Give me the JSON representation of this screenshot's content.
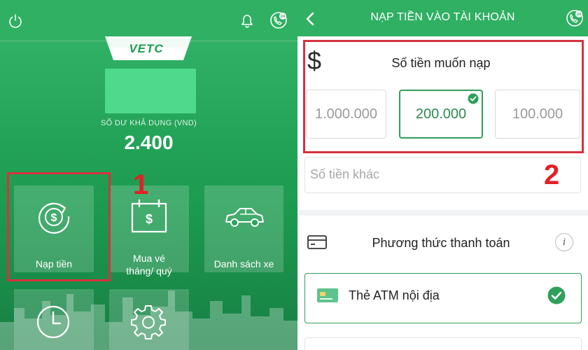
{
  "left": {
    "logo": "VETC",
    "balance_label": "SỐ DƯ KHẢ DỤNG (VND)",
    "balance_value": "2.400",
    "tiles": [
      {
        "label": "Nạp tiền"
      },
      {
        "label": "Mua vé tháng/ quý",
        "line1": "Mua vé",
        "line2": "tháng/ quý"
      },
      {
        "label": "Danh sách xe"
      }
    ],
    "marker": "1",
    "icons": [
      "power-icon",
      "bell-icon",
      "hotline-24-icon",
      "topup-dollar-icon",
      "ticket-calendar-icon",
      "car-icon",
      "clock-icon",
      "gear-icon"
    ],
    "badge_24": "24"
  },
  "right": {
    "header_title": "NẠP TIỀN VÀO TÀI KHOẢN",
    "badge_24": "24",
    "currency_symbol": "$",
    "amount_title": "Số tiền muốn nạp",
    "amounts": [
      {
        "value": "1.000.000",
        "selected": false
      },
      {
        "value": "200.000",
        "selected": true
      },
      {
        "value": "100.000",
        "selected": false
      }
    ],
    "other_amount_placeholder": "Số tiền khác",
    "marker": "2",
    "payment_title": "Phương thức thanh toán",
    "info_symbol": "i",
    "payment_options": [
      {
        "label": "Thẻ ATM nội địa",
        "selected": true
      }
    ]
  },
  "colors": {
    "brand_green": "#2fb062",
    "highlight_red": "#d6323f",
    "marker_red": "#e31e24",
    "selected_green": "#2f9f5a"
  }
}
